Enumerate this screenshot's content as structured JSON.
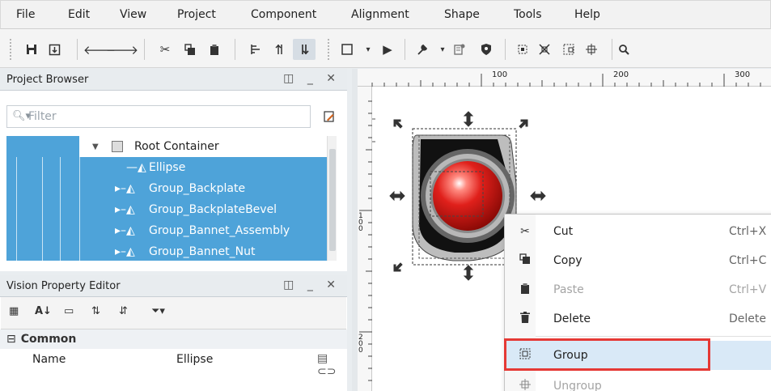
{
  "menu": [
    "File",
    "Edit",
    "View",
    "Project",
    "Component",
    "Alignment",
    "Shape",
    "Tools",
    "Help"
  ],
  "toolbar_icons": [
    "save-icon",
    "save-all-icon",
    "undo-icon",
    "redo-icon",
    "cut-icon",
    "copy-icon",
    "paste-icon",
    "align-icon",
    "move-icon",
    "move-active-icon",
    "select-rect-icon",
    "dropdown-arrow-icon",
    "play-icon",
    "wrench-icon",
    "dropdown-arrow-icon",
    "script-icon",
    "shield-icon",
    "group-icon",
    "ungroup-icon",
    "union-icon",
    "intersect-icon",
    "zoom-icon"
  ],
  "project_browser": {
    "title": "Project Browser",
    "controls": "◫ _ ✕",
    "filter_placeholder": "Filter",
    "tree": [
      {
        "label": "Root Container",
        "icon": "container-icon"
      },
      {
        "label": "Ellipse",
        "icon": "ellipse-icon"
      },
      {
        "label": "Group_Backplate",
        "icon": "group-shape-icon"
      },
      {
        "label": "Group_BackplateBevel",
        "icon": "group-shape-icon"
      },
      {
        "label": "Group_Bannet_Assembly",
        "icon": "group-shape-icon"
      },
      {
        "label": "Group_Bannet_Nut",
        "icon": "group-shape-icon"
      }
    ]
  },
  "property_editor": {
    "title": "Vision Property Editor",
    "controls": "◫ _ ✕",
    "section": "Common",
    "row": {
      "name": "Name",
      "value": "Ellipse"
    }
  },
  "ruler": {
    "top_labels": [
      "100",
      "200",
      "300"
    ],
    "left_labels": [
      "100",
      "200"
    ]
  },
  "context_menu": {
    "items": [
      {
        "label": "Cut",
        "shortcut": "Ctrl+X",
        "icon": "cut-icon",
        "enabled": true
      },
      {
        "label": "Copy",
        "shortcut": "Ctrl+C",
        "icon": "copy-icon",
        "enabled": true
      },
      {
        "label": "Paste",
        "shortcut": "Ctrl+V",
        "icon": "paste-icon",
        "enabled": false
      },
      {
        "label": "Delete",
        "shortcut": "Delete",
        "icon": "trash-icon",
        "enabled": true
      },
      {
        "label": "Group",
        "shortcut": "",
        "icon": "group-icon",
        "enabled": true,
        "highlighted": true
      },
      {
        "label": "Ungroup",
        "shortcut": "",
        "icon": "ungroup-icon",
        "enabled": false
      }
    ]
  },
  "colors": {
    "selection": "#4ea3d9",
    "highlight_border": "#e53935",
    "lamp": "#e0201b"
  }
}
